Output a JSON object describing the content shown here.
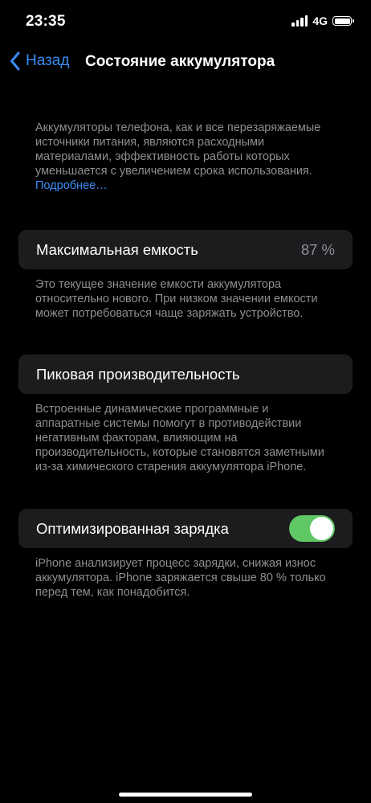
{
  "status_bar": {
    "time": "23:35",
    "network": "4G"
  },
  "nav": {
    "back_label": "Назад",
    "title": "Состояние аккумулятора"
  },
  "intro": {
    "text": "Аккумуляторы телефона, как и все перезаряжаемые источники питания, являются расходными материалами, эффективность работы которых уменьшается с увеличением срока использования. ",
    "link": "Подробнее…"
  },
  "max_capacity": {
    "label": "Максимальная емкость",
    "value": "87 %",
    "note": "Это текущее значение емкости аккумулятора относительно нового. При низком значении емкости может потребоваться чаще заряжать устройство."
  },
  "peak_performance": {
    "label": "Пиковая производительность",
    "note": "Встроенные динамические программные и аппаратные системы помогут в противодействии негативным факторам, влияющим на производительность, которые становятся заметными из-за химического старения аккумулятора iPhone."
  },
  "optimized_charging": {
    "label": "Оптимизированная зарядка",
    "enabled": true,
    "note": "iPhone анализирует процесс зарядки, снижая износ аккумулятора. iPhone заряжается свыше 80 % только перед тем, как понадобится."
  },
  "colors": {
    "accent": "#3b8ef6",
    "toggle_on": "#5fc865",
    "cell_background": "#1c1c1e",
    "secondary_text": "#8e8e93"
  }
}
